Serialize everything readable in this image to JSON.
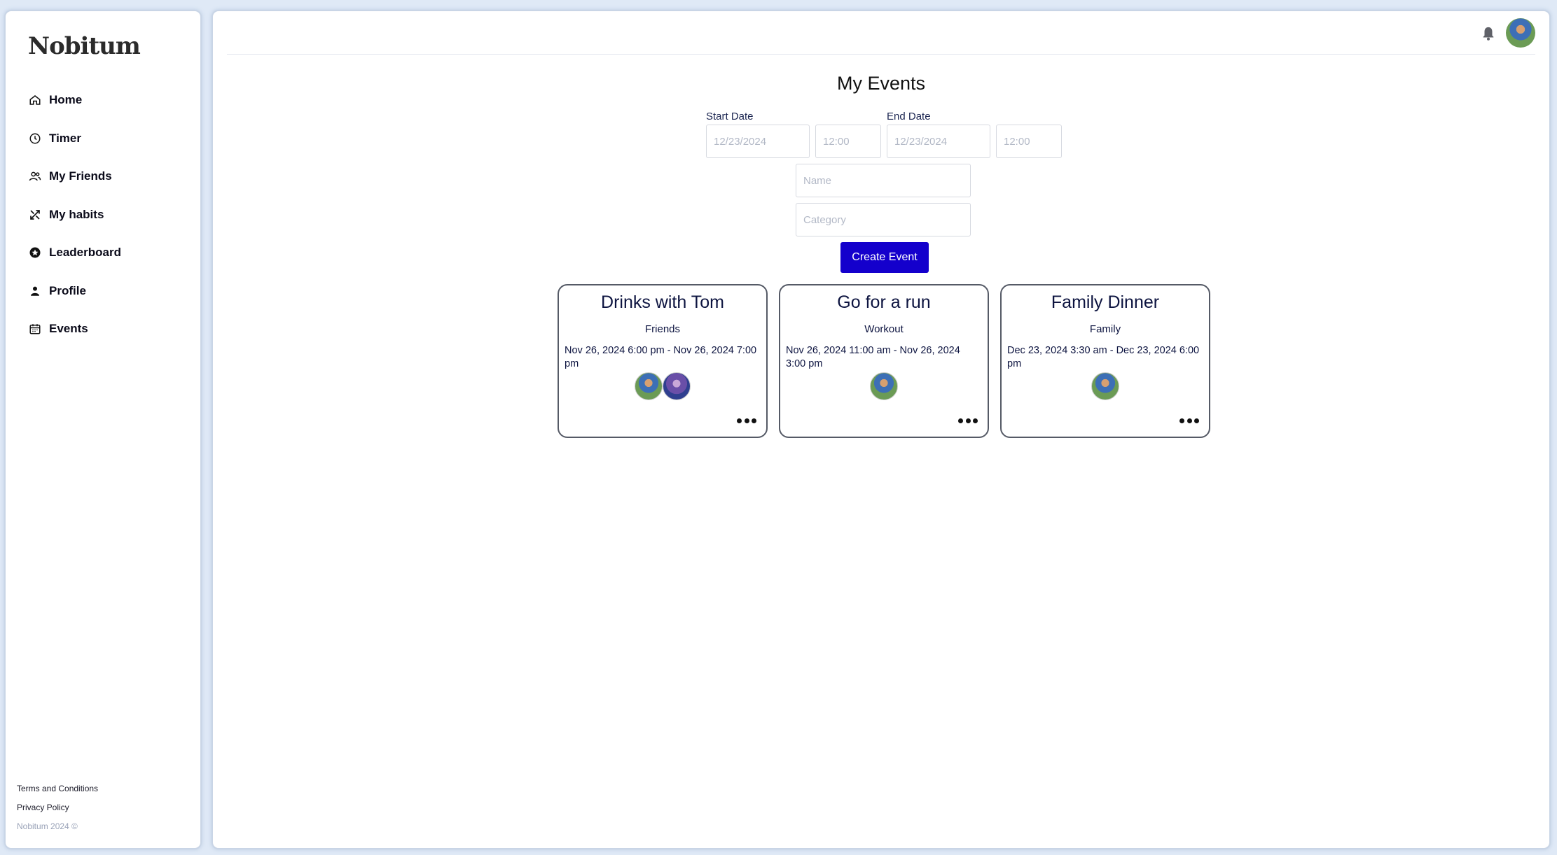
{
  "sidebar": {
    "logo": "Nobitum",
    "items": [
      {
        "label": "Home",
        "icon": "home-icon"
      },
      {
        "label": "Timer",
        "icon": "clock-icon"
      },
      {
        "label": "My Friends",
        "icon": "friends-icon"
      },
      {
        "label": "My habits",
        "icon": "habits-icon"
      },
      {
        "label": "Leaderboard",
        "icon": "star-icon"
      },
      {
        "label": "Profile",
        "icon": "person-icon"
      },
      {
        "label": "Events",
        "icon": "calendar-icon"
      }
    ],
    "footer": {
      "terms": "Terms and Conditions",
      "privacy": "Privacy Policy",
      "copyright": "Nobitum 2024 ©"
    }
  },
  "main": {
    "title": "My Events",
    "form": {
      "start_label": "Start Date",
      "end_label": "End Date",
      "start_date_placeholder": "12/23/2024",
      "start_time_placeholder": "12:00",
      "end_date_placeholder": "12/23/2024",
      "end_time_placeholder": "12:00",
      "name_placeholder": "Name",
      "category_placeholder": "Category",
      "create_label": "Create Event"
    },
    "events": [
      {
        "title": "Drinks with Tom",
        "category": "Friends",
        "dates": "Nov 26, 2024 6:00 pm - Nov 26, 2024 7:00 pm"
      },
      {
        "title": "Go for a run",
        "category": "Workout",
        "dates": "Nov 26, 2024 11:00 am - Nov 26, 2024 3:00 pm"
      },
      {
        "title": "Family Dinner",
        "category": "Family",
        "dates": "Dec 23, 2024 3:30 am - Dec 23, 2024 6:00 pm"
      }
    ]
  },
  "colors": {
    "accent": "#1400cc",
    "text": "#0d1440",
    "background": "#dfe9f6"
  }
}
